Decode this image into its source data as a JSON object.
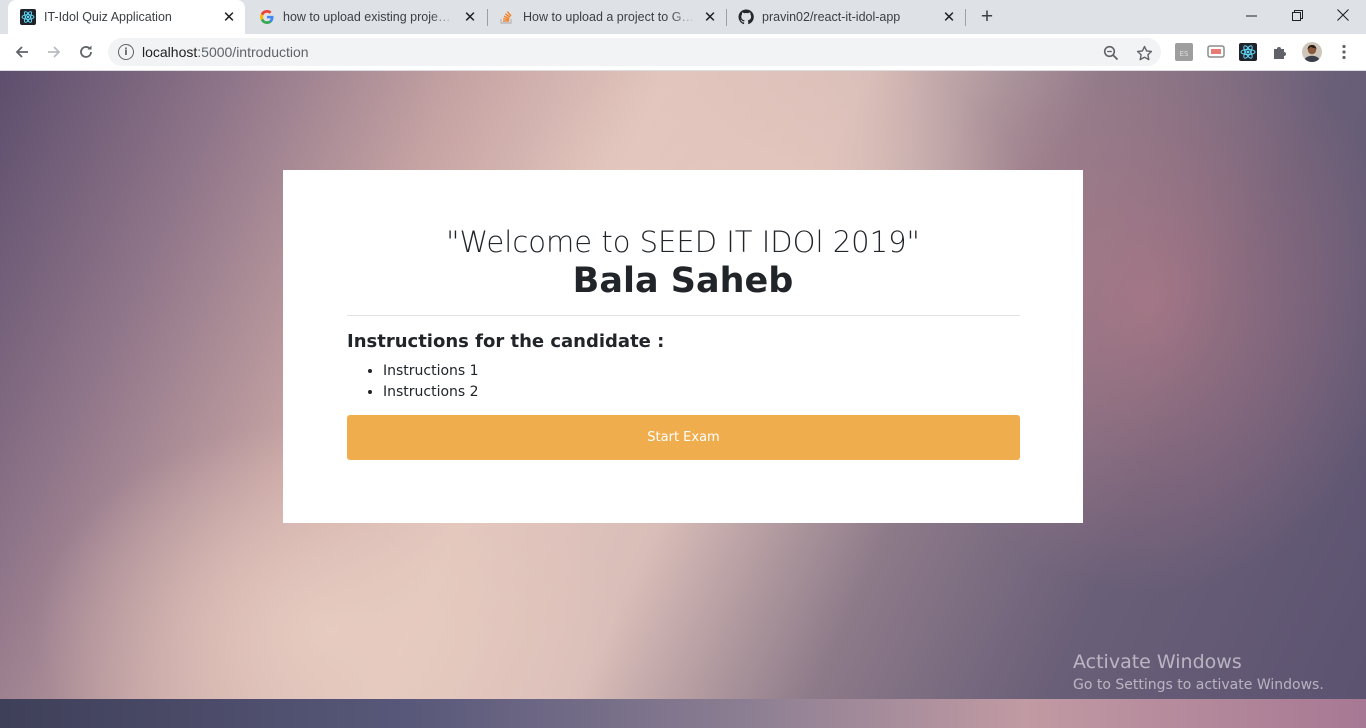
{
  "browser": {
    "tabs": [
      {
        "title": "IT-Idol Quiz Application",
        "icon": "react-icon",
        "active": true
      },
      {
        "title": "how to upload existing project on github",
        "icon": "google-icon",
        "active": false
      },
      {
        "title": "How to upload a project to Github - Stack Overflow",
        "icon": "stackoverflow-icon",
        "active": false
      },
      {
        "title": "pravin02/react-it-idol-app",
        "icon": "github-icon",
        "active": false
      }
    ],
    "address": {
      "host": "localhost",
      "path": ":5000/introduction"
    }
  },
  "page": {
    "welcome": "\"Welcome to SEED IT IDOl 2019\"",
    "candidate_name": "Bala Saheb",
    "instructions_title": "Instructions for the candidate :",
    "instructions": [
      "Instructions 1",
      "Instructions 2"
    ],
    "start_button": "Start Exam",
    "accent_color": "#f0ad4e"
  },
  "watermark": {
    "line1": "Activate Windows",
    "line2": "Go to Settings to activate Windows."
  }
}
